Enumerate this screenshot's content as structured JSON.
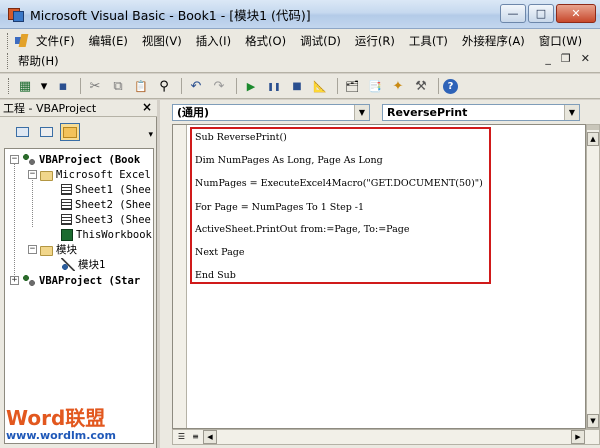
{
  "window": {
    "title": "Microsoft Visual Basic - Book1 - [模块1 (代码)]",
    "controls": [
      "—",
      "□",
      "✕"
    ]
  },
  "menubar": {
    "items": [
      "文件(F)",
      "编辑(E)",
      "视图(V)",
      "插入(I)",
      "格式(O)",
      "调试(D)",
      "运行(R)",
      "工具(T)",
      "外接程序(A)",
      "窗口(W)"
    ],
    "help": "帮助(H)",
    "mdi_controls": [
      "_",
      "❐",
      "✕"
    ]
  },
  "toolbar": {
    "buttons": [
      {
        "name": "view-excel",
        "glyph": "▦"
      },
      {
        "name": "insert-module",
        "glyph": "▾"
      },
      {
        "name": "save",
        "glyph": "▪"
      },
      {
        "name": "cut",
        "glyph": "✂"
      },
      {
        "name": "copy",
        "glyph": "⧉"
      },
      {
        "name": "paste",
        "glyph": "📋"
      },
      {
        "name": "find",
        "glyph": "⚲"
      },
      {
        "name": "undo",
        "glyph": "↶"
      },
      {
        "name": "redo",
        "glyph": "↷"
      },
      {
        "name": "run",
        "glyph": "▶"
      },
      {
        "name": "break",
        "glyph": "❚❚"
      },
      {
        "name": "reset",
        "glyph": "■"
      },
      {
        "name": "design-mode",
        "glyph": "📐"
      },
      {
        "name": "project-explorer",
        "glyph": "🗂"
      },
      {
        "name": "properties",
        "glyph": "📑"
      },
      {
        "name": "object-browser",
        "glyph": "✦"
      },
      {
        "name": "toolbox",
        "glyph": "⚒"
      },
      {
        "name": "help",
        "glyph": "?"
      }
    ]
  },
  "project_pane": {
    "title": "工程 - VBAProject",
    "close": "×",
    "tree": [
      {
        "label": "VBAProject (Book",
        "bold": true,
        "expander": "−",
        "icon": "project"
      },
      {
        "label": "Microsoft Excel",
        "bold": false,
        "expander": "−",
        "icon": "folder"
      },
      {
        "label": "Sheet1 (Shee",
        "bold": false,
        "expander": "",
        "icon": "sheet"
      },
      {
        "label": "Sheet2 (Shee",
        "bold": false,
        "expander": "",
        "icon": "sheet"
      },
      {
        "label": "Sheet3 (Shee",
        "bold": false,
        "expander": "",
        "icon": "sheet"
      },
      {
        "label": "ThisWorkbook",
        "bold": false,
        "expander": "",
        "icon": "workbook"
      },
      {
        "label": "模块",
        "bold": false,
        "expander": "−",
        "icon": "folder"
      },
      {
        "label": "模块1",
        "bold": false,
        "expander": "",
        "icon": "module"
      },
      {
        "label": "VBAProject (Star",
        "bold": true,
        "expander": "+",
        "icon": "project"
      }
    ]
  },
  "code_window": {
    "object_combo": "(通用)",
    "procedure_combo": "ReversePrint",
    "lines": [
      "Sub ReversePrint()",
      "Dim NumPages As Long, Page As Long",
      "NumPages = ExecuteExcel4Macro(\"GET.DOCUMENT(50)\")",
      "For Page = NumPages To 1 Step -1",
      "ActiveSheet.PrintOut from:=Page, To:=Page",
      "Next Page",
      "End Sub"
    ],
    "highlight_color": "#d01a1a"
  },
  "watermark": {
    "logo_latin": "Word",
    "logo_cjk": "联盟",
    "url": "www.wordlm.com"
  }
}
